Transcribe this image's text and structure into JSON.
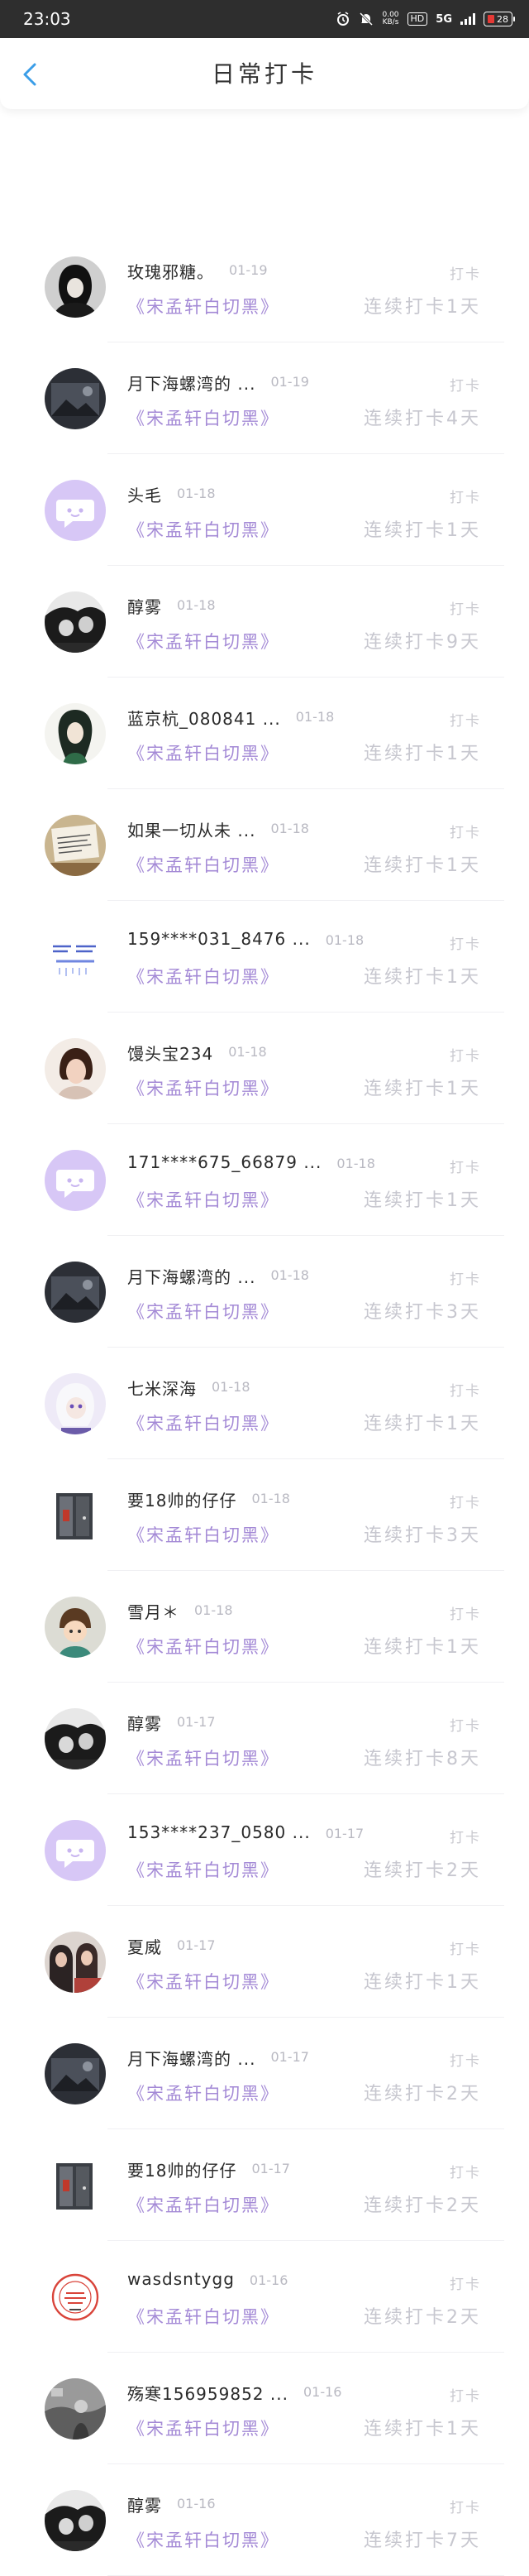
{
  "status_bar": {
    "time": "23:03",
    "net_speed_top": "0.00",
    "net_speed_bottom": "KB/s",
    "hd_label": "HD",
    "network": "5G",
    "battery": "28"
  },
  "header": {
    "title": "日常打卡"
  },
  "checkins": [
    {
      "name": "玫瑰邪糖。",
      "date": "01-19",
      "kind": "打卡",
      "book": "《宋孟轩白切黑》",
      "streak": "连续打卡1天",
      "avatar": "dark-hood"
    },
    {
      "name": "月下海螺湾的 ...",
      "date": "01-19",
      "kind": "打卡",
      "book": "《宋孟轩白切黑》",
      "streak": "连续打卡4天",
      "avatar": "dark-photo"
    },
    {
      "name": "头毛",
      "date": "01-18",
      "kind": "打卡",
      "book": "《宋孟轩白切黑》",
      "streak": "连续打卡1天",
      "avatar": "default"
    },
    {
      "name": "醇雾",
      "date": "01-18",
      "kind": "打卡",
      "book": "《宋孟轩白切黑》",
      "streak": "连续打卡9天",
      "avatar": "bw-couple"
    },
    {
      "name": "蓝京杭_080841 ...",
      "date": "01-18",
      "kind": "打卡",
      "book": "《宋孟轩白切黑》",
      "streak": "连续打卡1天",
      "avatar": "green-anime"
    },
    {
      "name": "如果一切从未 ...",
      "date": "01-18",
      "kind": "打卡",
      "book": "《宋孟轩白切黑》",
      "streak": "连续打卡1天",
      "avatar": "note"
    },
    {
      "name": "159****031_8476 ...",
      "date": "01-18",
      "kind": "打卡",
      "book": "《宋孟轩白切黑》",
      "streak": "连续打卡1天",
      "avatar": "text-blue"
    },
    {
      "name": "馒头宝234",
      "date": "01-18",
      "kind": "打卡",
      "book": "《宋孟轩白切黑》",
      "streak": "连续打卡1天",
      "avatar": "portrait"
    },
    {
      "name": "171****675_66879 ...",
      "date": "01-18",
      "kind": "打卡",
      "book": "《宋孟轩白切黑》",
      "streak": "连续打卡1天",
      "avatar": "default"
    },
    {
      "name": "月下海螺湾的 ...",
      "date": "01-18",
      "kind": "打卡",
      "book": "《宋孟轩白切黑》",
      "streak": "连续打卡3天",
      "avatar": "dark-photo"
    },
    {
      "name": "七米深海",
      "date": "01-18",
      "kind": "打卡",
      "book": "《宋孟轩白切黑》",
      "streak": "连续打卡1天",
      "avatar": "anime-purple"
    },
    {
      "name": "要18帅的仔仔",
      "date": "01-18",
      "kind": "打卡",
      "book": "《宋孟轩白切黑》",
      "streak": "连续打卡3天",
      "avatar": "door"
    },
    {
      "name": "雪月＊",
      "date": "01-18",
      "kind": "打卡",
      "book": "《宋孟轩白切黑》",
      "streak": "连续打卡1天",
      "avatar": "cartoon"
    },
    {
      "name": "醇雾",
      "date": "01-17",
      "kind": "打卡",
      "book": "《宋孟轩白切黑》",
      "streak": "连续打卡8天",
      "avatar": "bw-couple"
    },
    {
      "name": "153****237_0580 ...",
      "date": "01-17",
      "kind": "打卡",
      "book": "《宋孟轩白切黑》",
      "streak": "连续打卡2天",
      "avatar": "default"
    },
    {
      "name": "夏威",
      "date": "01-17",
      "kind": "打卡",
      "book": "《宋孟轩白切黑》",
      "streak": "连续打卡1天",
      "avatar": "people"
    },
    {
      "name": "月下海螺湾的 ...",
      "date": "01-17",
      "kind": "打卡",
      "book": "《宋孟轩白切黑》",
      "streak": "连续打卡2天",
      "avatar": "dark-photo"
    },
    {
      "name": "要18帅的仔仔",
      "date": "01-17",
      "kind": "打卡",
      "book": "《宋孟轩白切黑》",
      "streak": "连续打卡2天",
      "avatar": "door"
    },
    {
      "name": "wasdsntygg",
      "date": "01-16",
      "kind": "打卡",
      "book": "《宋孟轩白切黑》",
      "streak": "连续打卡2天",
      "avatar": "stamp"
    },
    {
      "name": "殇寒156959852 ...",
      "date": "01-16",
      "kind": "打卡",
      "book": "《宋孟轩白切黑》",
      "streak": "连续打卡1天",
      "avatar": "gray-photo"
    },
    {
      "name": "醇雾",
      "date": "01-16",
      "kind": "打卡",
      "book": "《宋孟轩白切黑》",
      "streak": "连续打卡7天",
      "avatar": "bw-couple"
    }
  ]
}
